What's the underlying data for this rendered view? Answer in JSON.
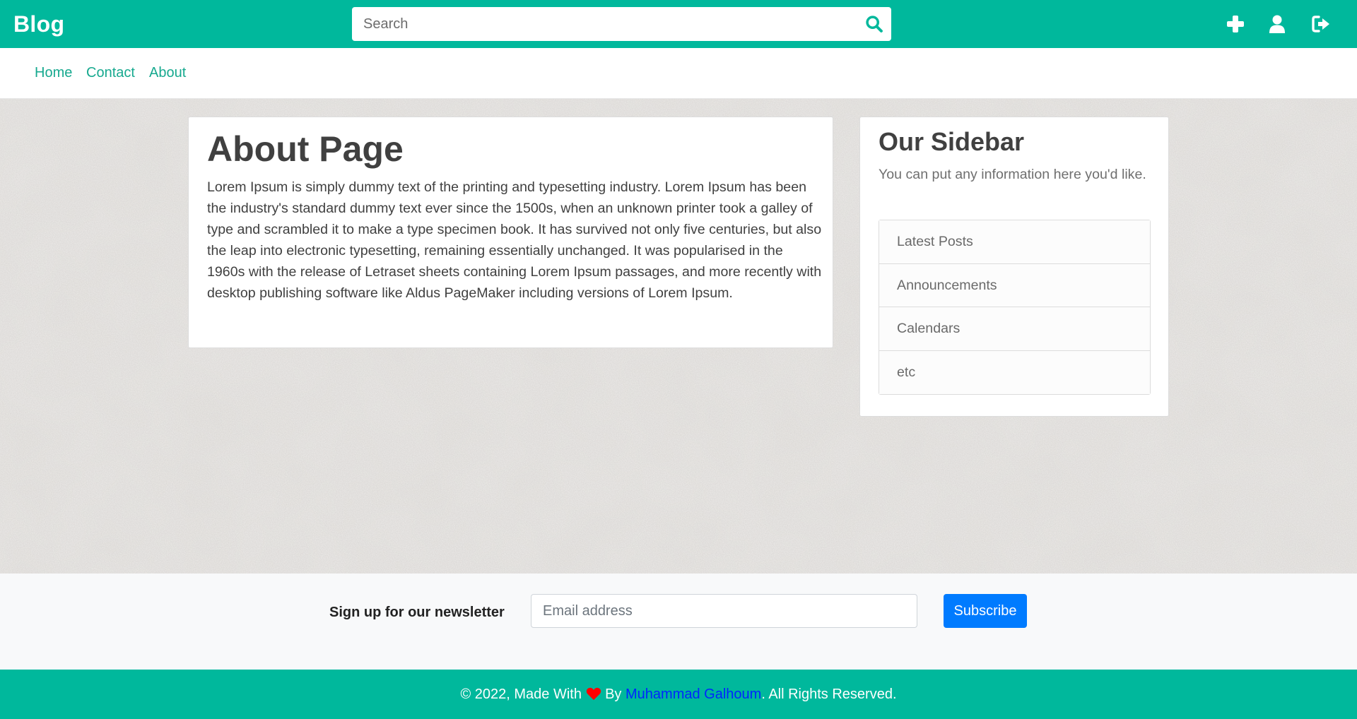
{
  "header": {
    "brand": "Blog",
    "search_placeholder": "Search",
    "icons": [
      "plus-icon",
      "user-icon",
      "sign-out-icon"
    ]
  },
  "nav": {
    "links": [
      "Home",
      "Contact",
      "About"
    ]
  },
  "main": {
    "title": "About Page",
    "body": "Lorem Ipsum is simply dummy text of the printing and typesetting industry. Lorem Ipsum has been the industry's standard dummy text ever since the 1500s, when an unknown printer took a galley of type and scrambled it to make a type specimen book. It has survived not only five centuries, but also the leap into electronic typesetting, remaining essentially unchanged. It was popularised in the 1960s with the release of Letraset sheets containing Lorem Ipsum passages, and more recently with desktop publishing software like Aldus PageMaker including versions of Lorem Ipsum."
  },
  "sidebar": {
    "title": "Our Sidebar",
    "description": "You can put any information here you'd like.",
    "items": [
      "Latest Posts",
      "Announcements",
      "Calendars",
      "etc"
    ]
  },
  "newsletter": {
    "label": "Sign up for our newsletter",
    "email_placeholder": "Email address",
    "button": "Subscribe"
  },
  "footer": {
    "prefix": "© 2022, Made With",
    "by": "By",
    "author": "Muhammad Galhoum",
    "suffix": ". All Rights Reserved."
  },
  "colors": {
    "primary": "#00b89c",
    "nav_link": "#17a98f",
    "subscribe": "#007bff",
    "heart": "#ff0000",
    "author_link": "#0026ff"
  }
}
